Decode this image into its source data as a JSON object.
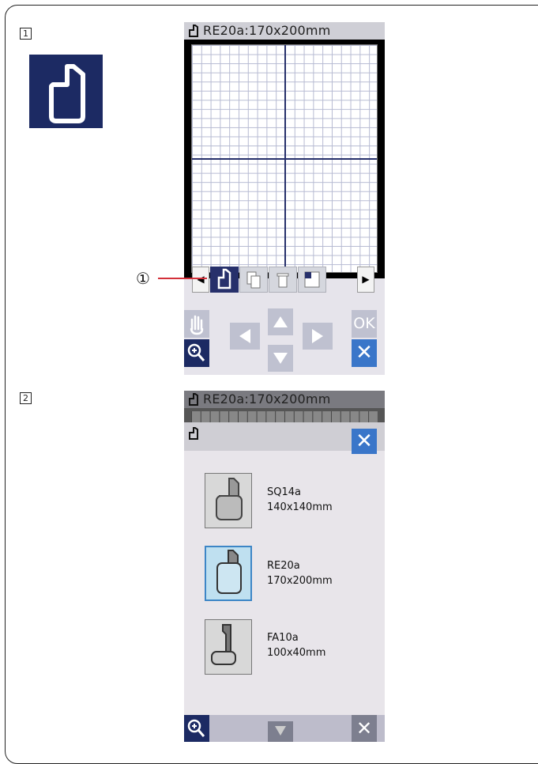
{
  "steps": {
    "step1": "1",
    "step2": "2"
  },
  "callout_label": "①",
  "screen1": {
    "title": "RE20a:170x200mm",
    "ok_label": "OK",
    "cancel_label": "✕"
  },
  "screen2": {
    "title": "RE20a:170x200mm",
    "hoops": [
      {
        "name": "SQ14a",
        "size": "140x140mm"
      },
      {
        "name": "RE20a",
        "size": "170x200mm"
      },
      {
        "name": "FA10a",
        "size": "100x40mm"
      }
    ],
    "close_label": "✕"
  },
  "colors": {
    "accent": "#1c2a63",
    "ok_blue": "#3a76c9",
    "selected_hoop": "#bfe0f0"
  }
}
